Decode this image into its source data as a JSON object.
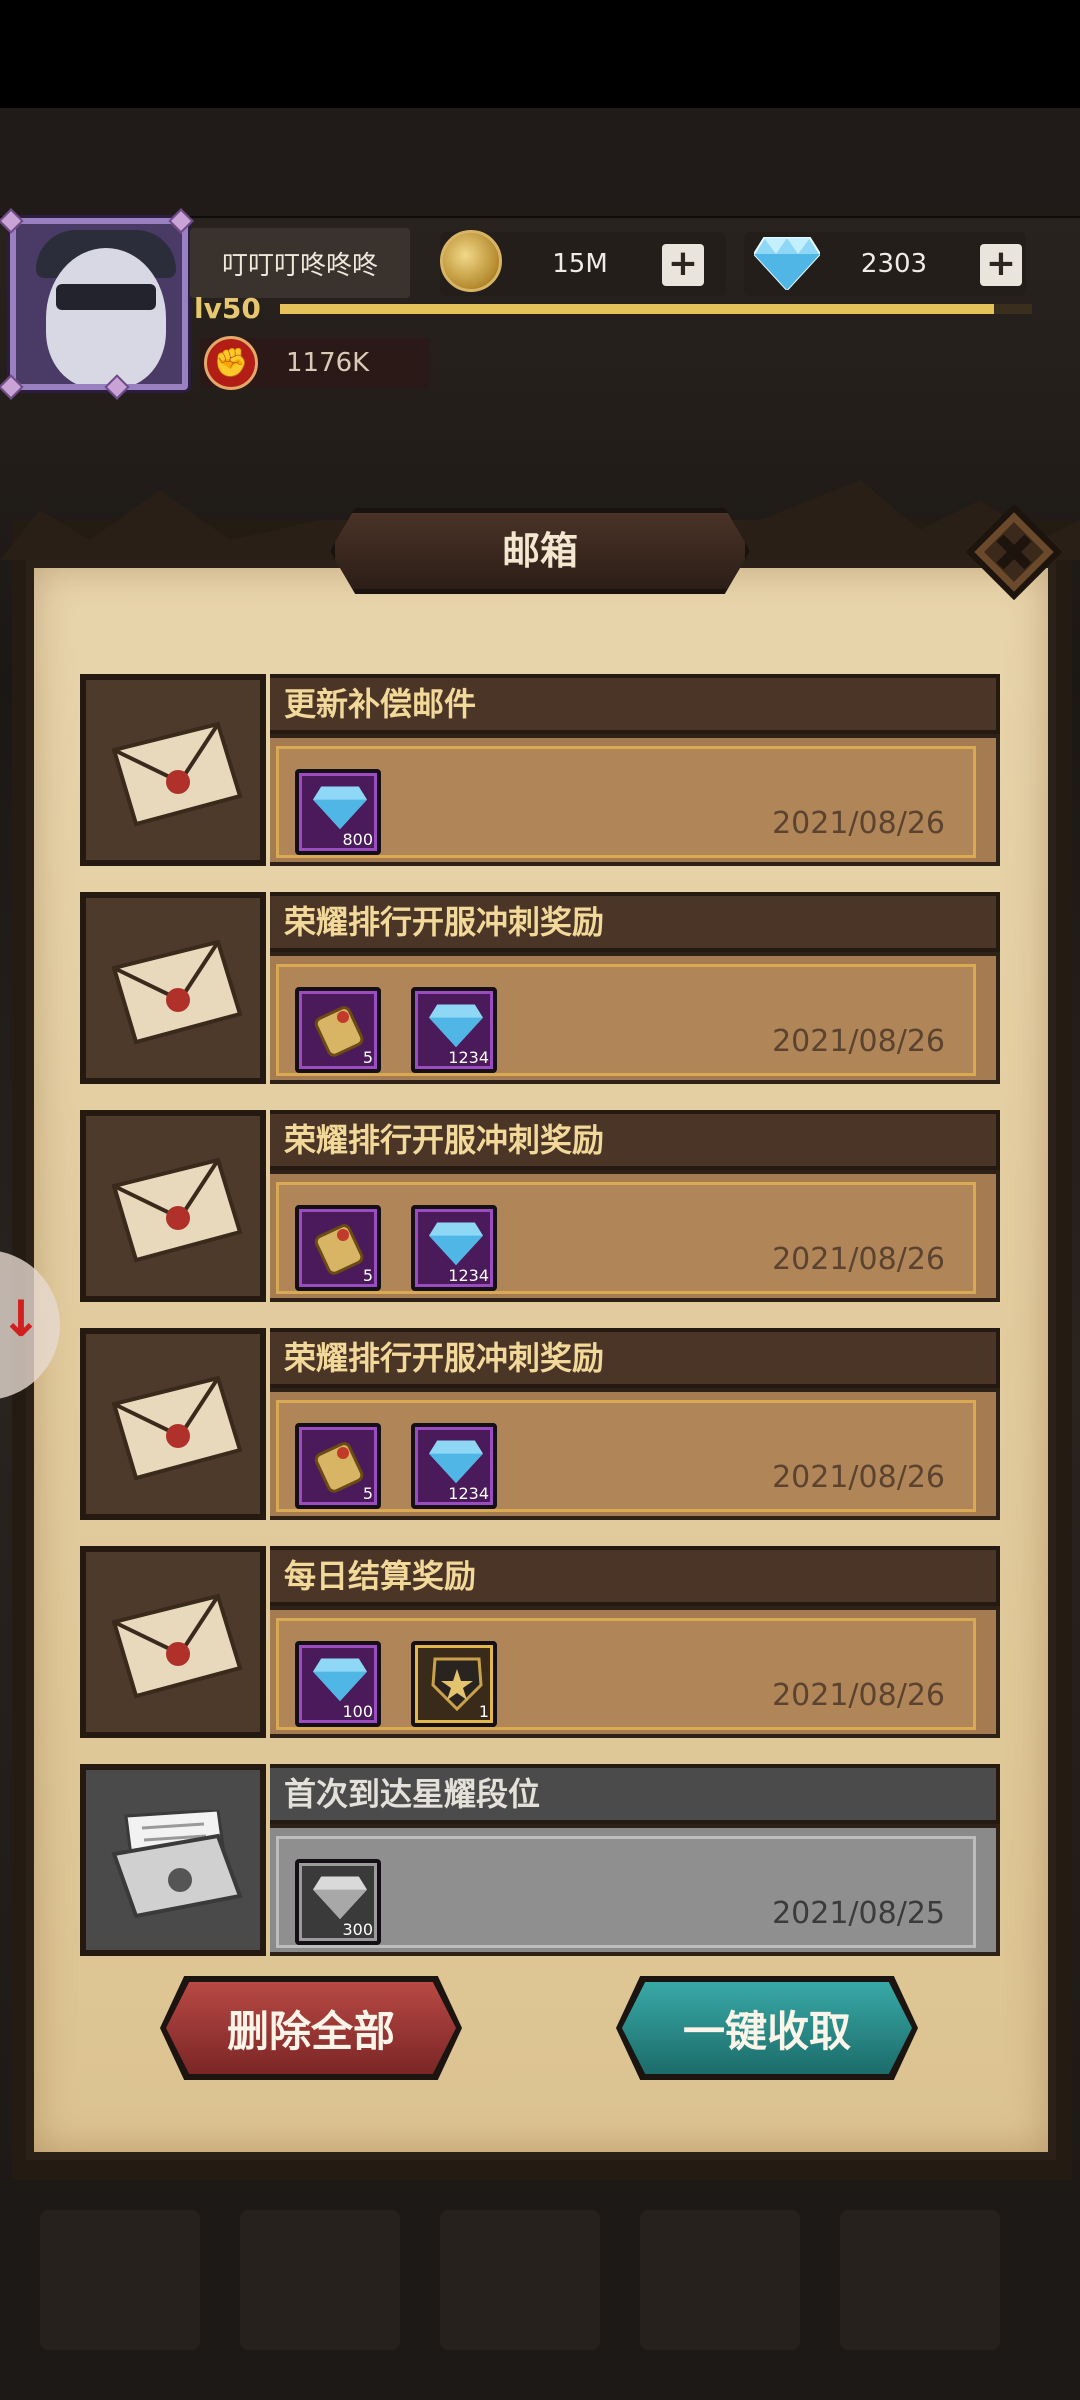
{
  "player": {
    "name": "叮叮叮咚咚咚",
    "level": "lv50",
    "level_progress": 0.95,
    "power": "1176K"
  },
  "currencies": {
    "gold": "15M",
    "diamonds": "2303"
  },
  "mailbox": {
    "title": "邮箱",
    "mails": [
      {
        "title": "更新补偿邮件",
        "date": "2021/08/26",
        "read": false,
        "rewards": [
          {
            "icon": "diamond-icon",
            "qty": "800"
          }
        ]
      },
      {
        "title": "荣耀排行开服冲刺奖励",
        "date": "2021/08/26",
        "read": false,
        "rewards": [
          {
            "icon": "scroll-icon",
            "qty": "5"
          },
          {
            "icon": "diamond-icon",
            "qty": "1234"
          }
        ]
      },
      {
        "title": "荣耀排行开服冲刺奖励",
        "date": "2021/08/26",
        "read": false,
        "rewards": [
          {
            "icon": "scroll-icon",
            "qty": "5"
          },
          {
            "icon": "diamond-icon",
            "qty": "1234"
          }
        ]
      },
      {
        "title": "荣耀排行开服冲刺奖励",
        "date": "2021/08/26",
        "read": false,
        "rewards": [
          {
            "icon": "scroll-icon",
            "qty": "5"
          },
          {
            "icon": "diamond-icon",
            "qty": "1234"
          }
        ]
      },
      {
        "title": "每日结算奖励",
        "date": "2021/08/26",
        "read": false,
        "rewards": [
          {
            "icon": "diamond-icon",
            "qty": "100"
          },
          {
            "icon": "star-badge-icon",
            "qty": "1"
          }
        ]
      },
      {
        "title": "首次到达星耀段位",
        "date": "2021/08/25",
        "read": true,
        "rewards": [
          {
            "icon": "diamond-icon",
            "qty": "300"
          }
        ]
      }
    ],
    "delete_all_label": "删除全部",
    "collect_all_label": "一键收取"
  },
  "colors": {
    "panel": "#e2cc9e",
    "title_gold": "#f2d99a",
    "delete_red": "#9b3333",
    "collect_teal": "#2a8a88"
  }
}
